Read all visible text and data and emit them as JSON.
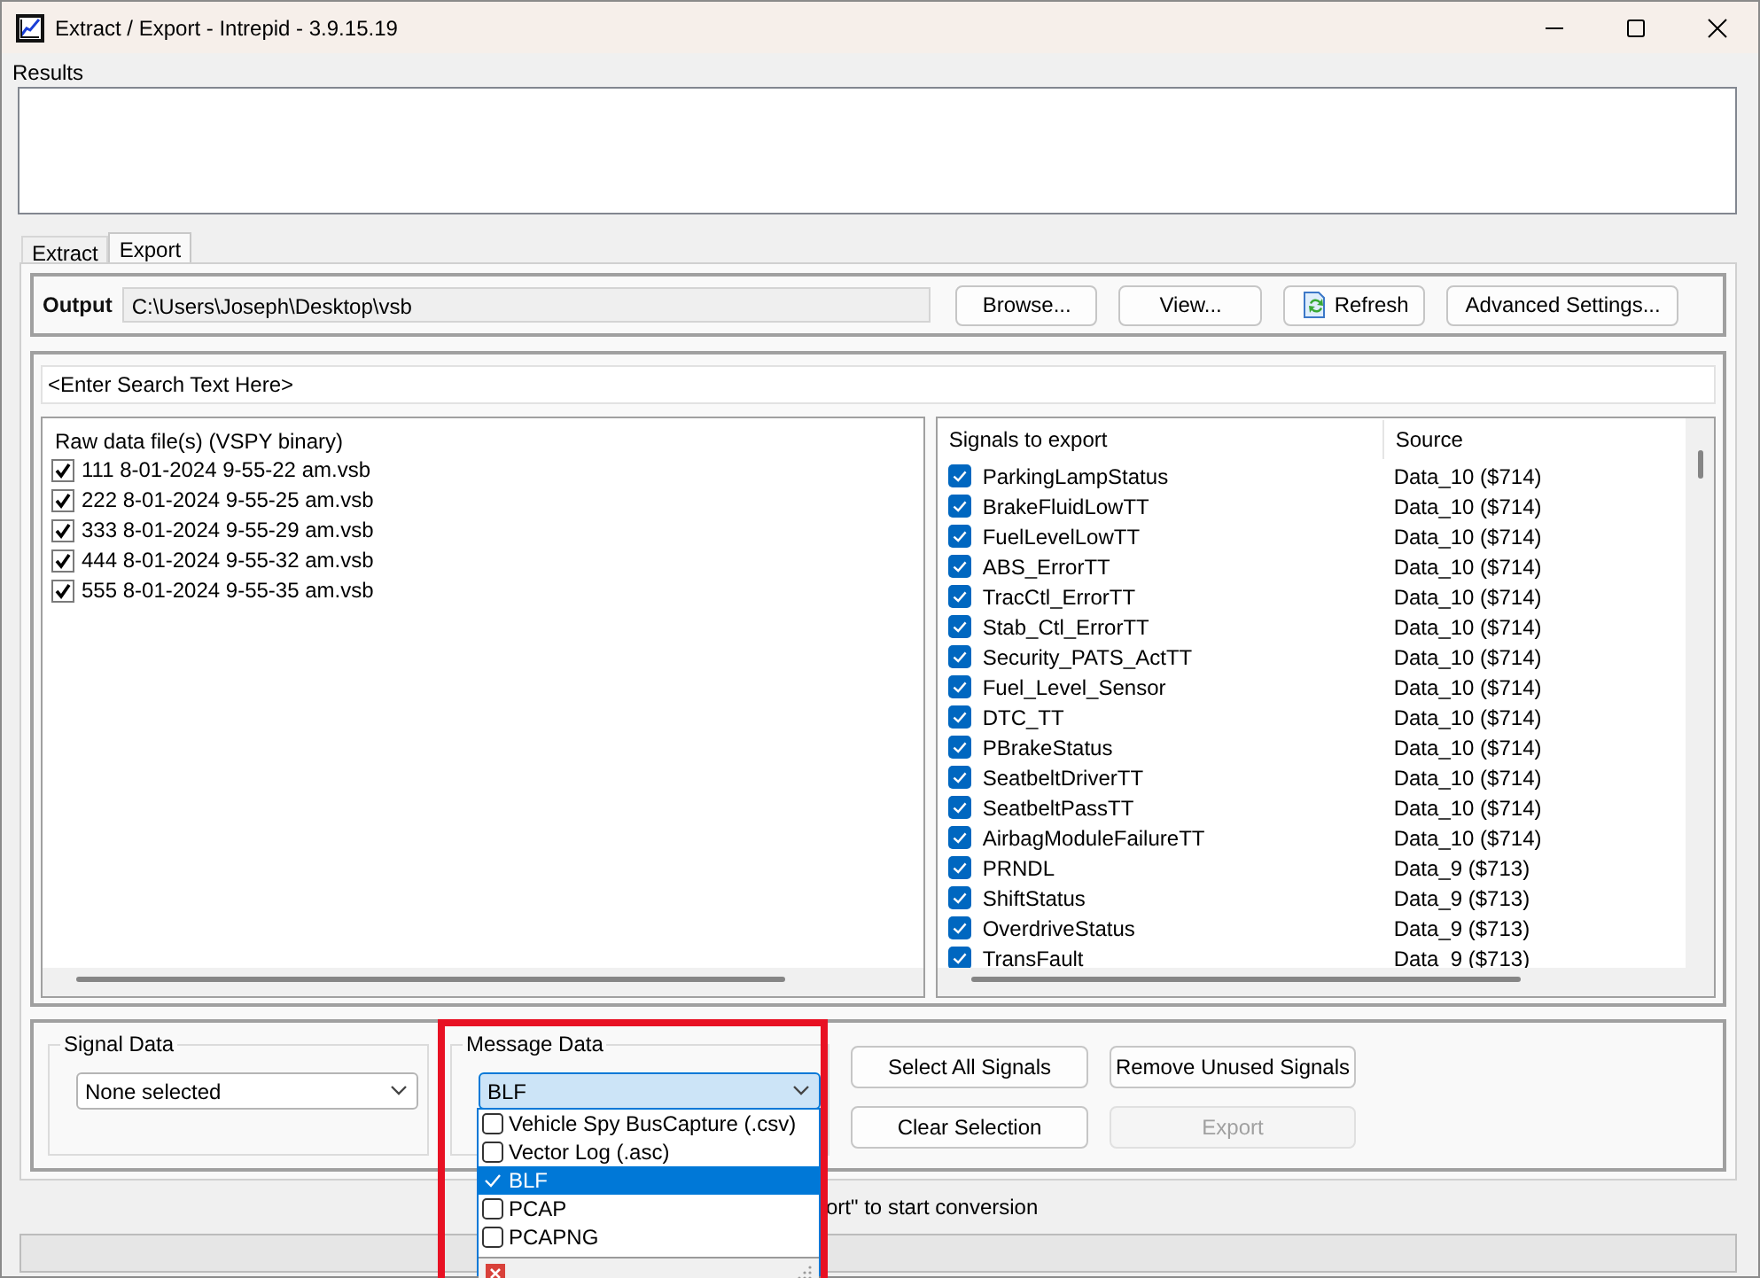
{
  "window": {
    "title": "Extract / Export - Intrepid - 3.9.15.19"
  },
  "results": {
    "label": "Results"
  },
  "tabs": [
    {
      "label": "Extract",
      "selected": false
    },
    {
      "label": "Export",
      "selected": true
    }
  ],
  "output": {
    "label": "Output",
    "path": "C:\\Users\\Joseph\\Desktop\\vsb",
    "buttons": [
      {
        "label": "Browse...",
        "kind": "plain"
      },
      {
        "label": "View...",
        "kind": "plain"
      },
      {
        "label": "Refresh",
        "kind": "refresh"
      },
      {
        "label": "Advanced Settings...",
        "kind": "plain"
      }
    ]
  },
  "search": {
    "value": "<Enter Search Text Here>"
  },
  "raw_files": {
    "heading": "Raw data file(s) (VSPY binary)",
    "items": [
      {
        "name": "111 8-01-2024 9-55-22 am.vsb",
        "checked": true
      },
      {
        "name": "222 8-01-2024 9-55-25 am.vsb",
        "checked": true
      },
      {
        "name": "333 8-01-2024 9-55-29 am.vsb",
        "checked": true
      },
      {
        "name": "444 8-01-2024 9-55-32 am.vsb",
        "checked": true
      },
      {
        "name": "555 8-01-2024 9-55-35 am.vsb",
        "checked": true
      }
    ]
  },
  "signals": {
    "columns": [
      "Signals to export",
      "Source"
    ],
    "rows": [
      {
        "name": "ParkingLampStatus",
        "source": "Data_10 ($714)",
        "checked": true
      },
      {
        "name": "BrakeFluidLowTT",
        "source": "Data_10 ($714)",
        "checked": true
      },
      {
        "name": "FuelLevelLowTT",
        "source": "Data_10 ($714)",
        "checked": true
      },
      {
        "name": "ABS_ErrorTT",
        "source": "Data_10 ($714)",
        "checked": true
      },
      {
        "name": "TracCtl_ErrorTT",
        "source": "Data_10 ($714)",
        "checked": true
      },
      {
        "name": "Stab_Ctl_ErrorTT",
        "source": "Data_10 ($714)",
        "checked": true
      },
      {
        "name": "Security_PATS_ActTT",
        "source": "Data_10 ($714)",
        "checked": true
      },
      {
        "name": "Fuel_Level_Sensor",
        "source": "Data_10 ($714)",
        "checked": true
      },
      {
        "name": "DTC_TT",
        "source": "Data_10 ($714)",
        "checked": true
      },
      {
        "name": "PBrakeStatus",
        "source": "Data_10 ($714)",
        "checked": true
      },
      {
        "name": "SeatbeltDriverTT",
        "source": "Data_10 ($714)",
        "checked": true
      },
      {
        "name": "SeatbeltPassTT",
        "source": "Data_10 ($714)",
        "checked": true
      },
      {
        "name": "AirbagModuleFailureTT",
        "source": "Data_10 ($714)",
        "checked": true
      },
      {
        "name": "PRNDL",
        "source": "Data_9 ($713)",
        "checked": true
      },
      {
        "name": "ShiftStatus",
        "source": "Data_9 ($713)",
        "checked": true
      },
      {
        "name": "OverdriveStatus",
        "source": "Data_9 ($713)",
        "checked": true
      },
      {
        "name": "TransFault",
        "source": "Data_9 ($713)",
        "checked": true
      }
    ]
  },
  "signal_data": {
    "label": "Signal Data",
    "value": "None selected"
  },
  "message_data": {
    "label": "Message Data",
    "value": "BLF",
    "expanded": true,
    "options": [
      {
        "label": "Vehicle Spy BusCapture (.csv)",
        "selected": false
      },
      {
        "label": "Vector Log (.asc)",
        "selected": false
      },
      {
        "label": "BLF",
        "selected": true
      },
      {
        "label": "PCAP",
        "selected": false
      },
      {
        "label": "PCAPNG",
        "selected": false
      }
    ]
  },
  "actions": [
    {
      "label": "Select All Signals",
      "disabled": false
    },
    {
      "label": "Remove Unused Signals",
      "disabled": false
    },
    {
      "label": "Clear Selection",
      "disabled": false
    },
    {
      "label": "Export",
      "disabled": true
    }
  ],
  "status_text": "ort\" to start conversion",
  "progress": {
    "level": 0
  }
}
